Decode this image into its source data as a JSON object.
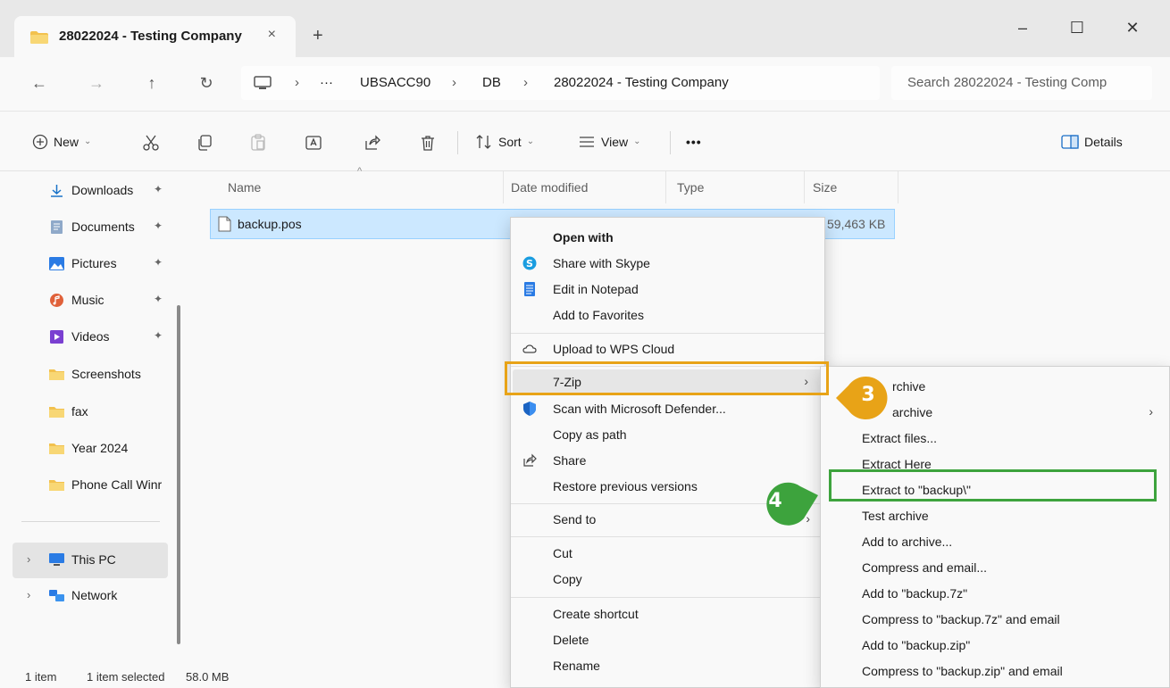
{
  "window": {
    "tab_title": "28022024 - Testing Company",
    "tab_close": "×",
    "new_tab": "+",
    "minimize": "–",
    "maximize": "☐",
    "close": "✕"
  },
  "nav": {
    "back": "←",
    "forward": "→",
    "up": "↑",
    "refresh": "↻"
  },
  "address": {
    "overflow": "···",
    "separator": "›",
    "crumbs": [
      "UBSACC90",
      "DB",
      "28022024 - Testing Company"
    ]
  },
  "search": {
    "placeholder": "Search 28022024 - Testing Comp"
  },
  "toolbar": {
    "new_label": "New",
    "sort_label": "Sort",
    "view_label": "View",
    "more_label": "•••",
    "details_label": "Details",
    "caret": "⌄"
  },
  "sidebar": {
    "items": [
      {
        "label": "Downloads",
        "icon": "download-icon",
        "pinned": true
      },
      {
        "label": "Documents",
        "icon": "documents-icon",
        "pinned": true
      },
      {
        "label": "Pictures",
        "icon": "pictures-icon",
        "pinned": true
      },
      {
        "label": "Music",
        "icon": "music-icon",
        "pinned": true
      },
      {
        "label": "Videos",
        "icon": "videos-icon",
        "pinned": true
      },
      {
        "label": "Screenshots",
        "icon": "folder-icon",
        "pinned": false
      },
      {
        "label": "fax",
        "icon": "folder-icon",
        "pinned": false
      },
      {
        "label": "Year 2024",
        "icon": "folder-icon",
        "pinned": false
      },
      {
        "label": "Phone Call Winr",
        "icon": "folder-icon",
        "pinned": false
      }
    ],
    "this_pc": "This PC",
    "network": "Network",
    "pin_glyph": "📌",
    "chevron": "›"
  },
  "columns": {
    "name": "Name",
    "date_modified": "Date modified",
    "type": "Type",
    "size": "Size",
    "sort_indicator": "^"
  },
  "file": {
    "name": "backup.pos",
    "size": "59,463 KB"
  },
  "status": {
    "count": "1 item",
    "selected": "1 item selected",
    "size": "58.0 MB"
  },
  "context_menu": {
    "open_with": "Open with",
    "share_skype": "Share with Skype",
    "edit_notepad": "Edit in Notepad",
    "add_favorites": "Add to Favorites",
    "upload_wps": "Upload to WPS Cloud",
    "seven_zip": "7-Zip",
    "scan_defender": "Scan with Microsoft Defender...",
    "copy_path": "Copy as path",
    "share": "Share",
    "restore": "Restore previous versions",
    "send_to": "Send to",
    "cut": "Cut",
    "copy": "Copy",
    "create_shortcut": "Create shortcut",
    "delete": "Delete",
    "rename": "Rename",
    "arrow": "›"
  },
  "submenu": {
    "open_archive": "rchive",
    "open_archive2": "archive",
    "extract_files": "Extract files...",
    "extract_here": "Extract Here",
    "extract_to": "Extract to \"backup\\\"",
    "test_archive": "Test archive",
    "add_archive": "Add to archive...",
    "compress_email": "Compress and email...",
    "add_7z": "Add to \"backup.7z\"",
    "compress_7z_email": "Compress to \"backup.7z\" and email",
    "add_zip": "Add to \"backup.zip\"",
    "compress_zip_email": "Compress to \"backup.zip\" and email"
  },
  "annotations": {
    "step3": "3",
    "step4": "4",
    "orange": "#e8a317",
    "green": "#3da33d"
  }
}
